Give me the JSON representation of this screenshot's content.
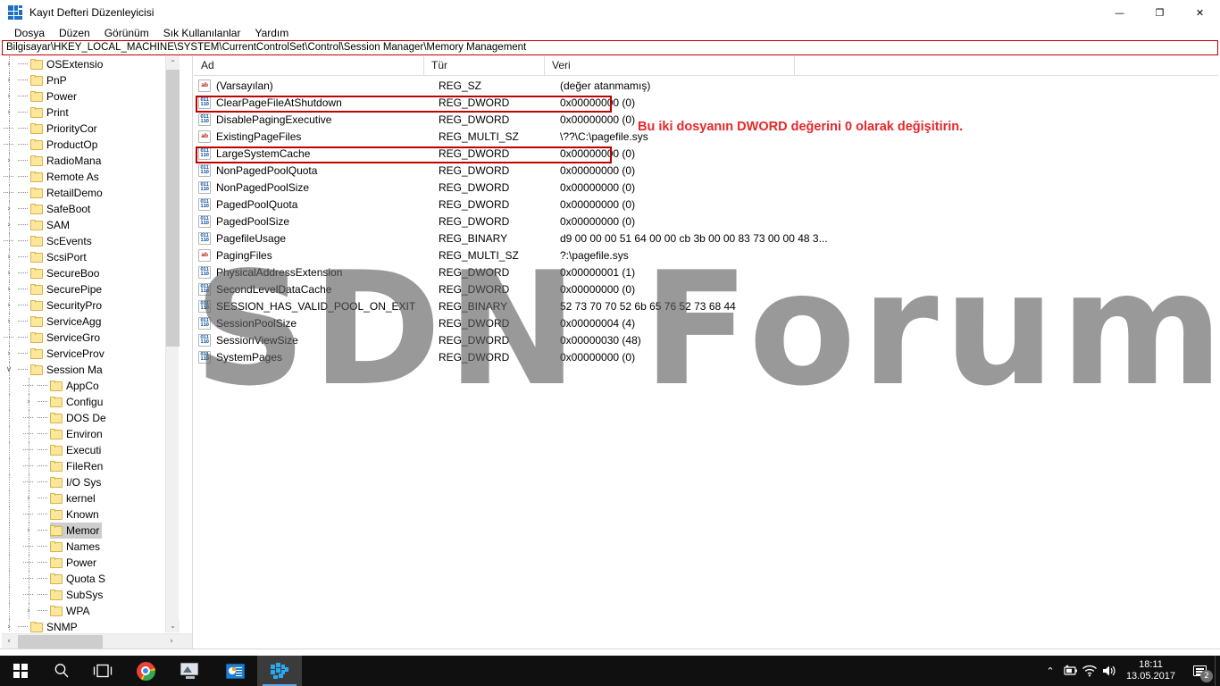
{
  "window": {
    "title": "Kayıt Defteri Düzenleyicisi",
    "icon": "registry-editor-icon",
    "minimize_label": "—",
    "maximize_label": "❐",
    "close_label": "✕"
  },
  "menu": {
    "items": [
      {
        "label": "Dosya",
        "name": "menu-dosya"
      },
      {
        "label": "Düzen",
        "name": "menu-duzen"
      },
      {
        "label": "Görünüm",
        "name": "menu-gorunum"
      },
      {
        "label": "Sık Kullanılanlar",
        "name": "menu-sik-kullanilanlar"
      },
      {
        "label": "Yardım",
        "name": "menu-yardim"
      }
    ]
  },
  "address": {
    "path": "Bilgisayar\\HKEY_LOCAL_MACHINE\\SYSTEM\\CurrentControlSet\\Control\\Session Manager\\Memory Management",
    "highlight_color": "#c00000"
  },
  "tree": {
    "items": [
      {
        "label": "OSExtensio",
        "indent": 1,
        "expander": "›",
        "has_children": true,
        "selected": false
      },
      {
        "label": "PnP",
        "indent": 1,
        "expander": "›",
        "has_children": true,
        "selected": false
      },
      {
        "label": "Power",
        "indent": 1,
        "expander": "›",
        "has_children": true,
        "selected": false
      },
      {
        "label": "Print",
        "indent": 1,
        "expander": "›",
        "has_children": true,
        "selected": false
      },
      {
        "label": "PriorityCor",
        "indent": 1,
        "expander": "",
        "has_children": false,
        "selected": false
      },
      {
        "label": "ProductOp",
        "indent": 1,
        "expander": "",
        "has_children": false,
        "selected": false
      },
      {
        "label": "RadioMana",
        "indent": 1,
        "expander": "›",
        "has_children": true,
        "selected": false
      },
      {
        "label": "Remote As",
        "indent": 1,
        "expander": "",
        "has_children": false,
        "selected": false
      },
      {
        "label": "RetailDemo",
        "indent": 1,
        "expander": "",
        "has_children": false,
        "selected": false
      },
      {
        "label": "SafeBoot",
        "indent": 1,
        "expander": "›",
        "has_children": true,
        "selected": false
      },
      {
        "label": "SAM",
        "indent": 1,
        "expander": "›",
        "has_children": true,
        "selected": false
      },
      {
        "label": "ScEvents",
        "indent": 1,
        "expander": "",
        "has_children": false,
        "selected": false
      },
      {
        "label": "ScsiPort",
        "indent": 1,
        "expander": "›",
        "has_children": true,
        "selected": false
      },
      {
        "label": "SecureBoo",
        "indent": 1,
        "expander": "›",
        "has_children": true,
        "selected": false
      },
      {
        "label": "SecurePipe",
        "indent": 1,
        "expander": "›",
        "has_children": true,
        "selected": false
      },
      {
        "label": "SecurityPro",
        "indent": 1,
        "expander": "›",
        "has_children": true,
        "selected": false
      },
      {
        "label": "ServiceAgg",
        "indent": 1,
        "expander": "›",
        "has_children": true,
        "selected": false
      },
      {
        "label": "ServiceGro",
        "indent": 1,
        "expander": "",
        "has_children": false,
        "selected": false
      },
      {
        "label": "ServiceProv",
        "indent": 1,
        "expander": "›",
        "has_children": true,
        "selected": false
      },
      {
        "label": "Session Ma",
        "indent": 1,
        "expander": "∨",
        "has_children": true,
        "selected": false
      },
      {
        "label": "AppCo",
        "indent": 2,
        "expander": "",
        "has_children": false,
        "selected": false
      },
      {
        "label": "Configu",
        "indent": 2,
        "expander": "›",
        "has_children": true,
        "selected": false
      },
      {
        "label": "DOS De",
        "indent": 2,
        "expander": "",
        "has_children": false,
        "selected": false
      },
      {
        "label": "Environ",
        "indent": 2,
        "expander": "",
        "has_children": false,
        "selected": false
      },
      {
        "label": "Executi",
        "indent": 2,
        "expander": "",
        "has_children": false,
        "selected": false
      },
      {
        "label": "FileRen",
        "indent": 2,
        "expander": "",
        "has_children": false,
        "selected": false
      },
      {
        "label": "I/O Sys",
        "indent": 2,
        "expander": "",
        "has_children": false,
        "selected": false
      },
      {
        "label": "kernel",
        "indent": 2,
        "expander": "›",
        "has_children": true,
        "selected": false
      },
      {
        "label": "Known",
        "indent": 2,
        "expander": "",
        "has_children": false,
        "selected": false
      },
      {
        "label": "Memor",
        "indent": 2,
        "expander": "›",
        "has_children": true,
        "selected": true
      },
      {
        "label": "Names",
        "indent": 2,
        "expander": "",
        "has_children": false,
        "selected": false
      },
      {
        "label": "Power",
        "indent": 2,
        "expander": "",
        "has_children": false,
        "selected": false
      },
      {
        "label": "Quota S",
        "indent": 2,
        "expander": "",
        "has_children": false,
        "selected": false
      },
      {
        "label": "SubSys",
        "indent": 2,
        "expander": "",
        "has_children": false,
        "selected": false
      },
      {
        "label": "WPA",
        "indent": 2,
        "expander": "›",
        "has_children": true,
        "selected": false
      },
      {
        "label": "SNMP",
        "indent": 1,
        "expander": "›",
        "has_children": true,
        "selected": false
      }
    ],
    "scroll_up": "⌃",
    "scroll_down": "⌄",
    "scroll_left": "‹",
    "scroll_right": "›"
  },
  "list": {
    "columns": [
      {
        "label": "Ad",
        "name": "column-header-ad"
      },
      {
        "label": "Tür",
        "name": "column-header-tur"
      },
      {
        "label": "Veri",
        "name": "column-header-veri"
      }
    ],
    "rows": [
      {
        "icon": "string-value-icon",
        "icon_kind": "sz",
        "name": "(Varsayılan)",
        "type": "REG_SZ",
        "data": "(değer atanmamış)",
        "highlighted": false
      },
      {
        "icon": "dword-value-icon",
        "icon_kind": "bin",
        "name": "ClearPageFileAtShutdown",
        "type": "REG_DWORD",
        "data": "0x00000000 (0)",
        "highlighted": true
      },
      {
        "icon": "dword-value-icon",
        "icon_kind": "bin",
        "name": "DisablePagingExecutive",
        "type": "REG_DWORD",
        "data": "0x00000000 (0)",
        "highlighted": false
      },
      {
        "icon": "string-value-icon",
        "icon_kind": "sz",
        "name": "ExistingPageFiles",
        "type": "REG_MULTI_SZ",
        "data": "\\??\\C:\\pagefile.sys",
        "highlighted": false
      },
      {
        "icon": "dword-value-icon",
        "icon_kind": "bin",
        "name": "LargeSystemCache",
        "type": "REG_DWORD",
        "data": "0x00000000 (0)",
        "highlighted": true
      },
      {
        "icon": "dword-value-icon",
        "icon_kind": "bin",
        "name": "NonPagedPoolQuota",
        "type": "REG_DWORD",
        "data": "0x00000000 (0)",
        "highlighted": false
      },
      {
        "icon": "dword-value-icon",
        "icon_kind": "bin",
        "name": "NonPagedPoolSize",
        "type": "REG_DWORD",
        "data": "0x00000000 (0)",
        "highlighted": false
      },
      {
        "icon": "dword-value-icon",
        "icon_kind": "bin",
        "name": "PagedPoolQuota",
        "type": "REG_DWORD",
        "data": "0x00000000 (0)",
        "highlighted": false
      },
      {
        "icon": "dword-value-icon",
        "icon_kind": "bin",
        "name": "PagedPoolSize",
        "type": "REG_DWORD",
        "data": "0x00000000 (0)",
        "highlighted": false
      },
      {
        "icon": "dword-value-icon",
        "icon_kind": "bin",
        "name": "PagefileUsage",
        "type": "REG_BINARY",
        "data": "d9 00 00 00 51 64 00 00 cb 3b 00 00 83 73 00 00 48 3...",
        "highlighted": false
      },
      {
        "icon": "string-value-icon",
        "icon_kind": "sz",
        "name": "PagingFiles",
        "type": "REG_MULTI_SZ",
        "data": "?:\\pagefile.sys",
        "highlighted": false
      },
      {
        "icon": "dword-value-icon",
        "icon_kind": "bin",
        "name": "PhysicalAddressExtension",
        "type": "REG_DWORD",
        "data": "0x00000001 (1)",
        "highlighted": false
      },
      {
        "icon": "dword-value-icon",
        "icon_kind": "bin",
        "name": "SecondLevelDataCache",
        "type": "REG_DWORD",
        "data": "0x00000000 (0)",
        "highlighted": false
      },
      {
        "icon": "dword-value-icon",
        "icon_kind": "bin",
        "name": "SESSION_HAS_VALID_POOL_ON_EXIT",
        "type": "REG_BINARY",
        "data": "52 73 70 70 52 6b 65 76 52 73 68 44",
        "highlighted": false
      },
      {
        "icon": "dword-value-icon",
        "icon_kind": "bin",
        "name": "SessionPoolSize",
        "type": "REG_DWORD",
        "data": "0x00000004 (4)",
        "highlighted": false
      },
      {
        "icon": "dword-value-icon",
        "icon_kind": "bin",
        "name": "SessionViewSize",
        "type": "REG_DWORD",
        "data": "0x00000030 (48)",
        "highlighted": false
      },
      {
        "icon": "dword-value-icon",
        "icon_kind": "bin",
        "name": "SystemPages",
        "type": "REG_DWORD",
        "data": "0x00000000 (0)",
        "highlighted": false
      }
    ]
  },
  "annotation": {
    "text": "Bu iki dosyanın DWORD değerini 0 olarak değişitirin.",
    "color": "#e8262a"
  },
  "watermark": {
    "text": "SDN Forum"
  },
  "taskbar": {
    "buttons": [
      {
        "name": "start-button",
        "icon": "windows-logo-icon"
      },
      {
        "name": "search-button",
        "icon": "search-icon"
      },
      {
        "name": "task-view-button",
        "icon": "task-view-icon"
      },
      {
        "name": "taskbar-chrome",
        "icon": "chrome-icon"
      },
      {
        "name": "taskbar-monitor-app",
        "icon": "monitor-icon"
      },
      {
        "name": "taskbar-office-app",
        "icon": "office-app-icon"
      },
      {
        "name": "taskbar-registry-editor",
        "icon": "registry-editor-icon"
      }
    ],
    "tray": {
      "overflow": "⌃",
      "icons": [
        {
          "name": "battery-icon",
          "label": "battery"
        },
        {
          "name": "wifi-icon",
          "label": "wifi"
        },
        {
          "name": "volume-icon",
          "label": "volume"
        }
      ],
      "time": "18:11",
      "date": "13.05.2017",
      "action_center_badge": "2"
    }
  }
}
